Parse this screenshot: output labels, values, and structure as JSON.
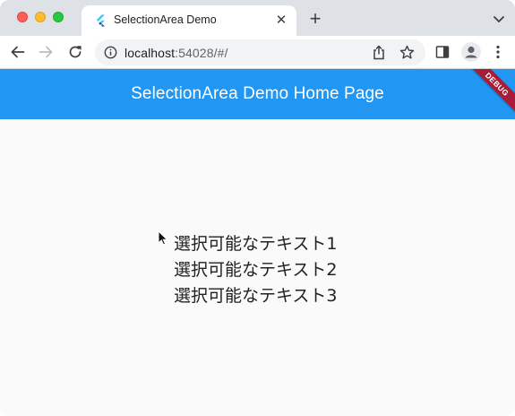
{
  "browser": {
    "tab": {
      "title": "SelectionArea Demo",
      "close_glyph": "✕"
    },
    "new_tab_glyph": "+",
    "address_bar": {
      "host": "localhost",
      "rest": ":54028/#/"
    },
    "icons": {
      "window_close": "traffic-light-close",
      "window_minimize": "traffic-light-minimize",
      "window_maximize": "traffic-light-maximize",
      "favicon": "flutter-logo",
      "tab_search": "chevron-down-icon",
      "back": "arrow-left-icon",
      "forward": "arrow-right-icon",
      "reload": "reload-icon",
      "site_info": "info-icon",
      "share": "share-icon",
      "bookmark": "star-icon",
      "side_panel": "side-panel-icon",
      "profile": "profile-icon",
      "menu": "kebab-menu-icon"
    }
  },
  "app": {
    "appbar_title": "SelectionArea Demo Home Page",
    "debug_banner": "DEBUG",
    "appbar_color": "#2196f3",
    "lines": [
      "選択可能なテキスト1",
      "選択可能なテキスト2",
      "選択可能なテキスト3"
    ]
  }
}
